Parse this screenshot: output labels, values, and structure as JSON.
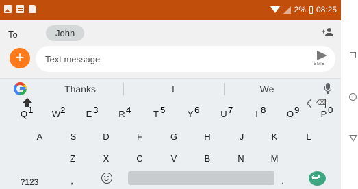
{
  "status_bar": {
    "notification_icons": [
      "image-icon",
      "calendar-icon",
      "document-icon"
    ],
    "battery": "2%",
    "time": "08:25"
  },
  "compose": {
    "to_label": "To",
    "recipient": "John",
    "add_contact_icon": "add-contact-icon",
    "add_button_symbol": "+",
    "message_placeholder": "Text message",
    "send_label": "SMS"
  },
  "keyboard": {
    "suggestions": [
      "Thanks",
      "I",
      "We"
    ],
    "row1": [
      {
        "key": "Q",
        "hint": "1"
      },
      {
        "key": "W",
        "hint": "2"
      },
      {
        "key": "E",
        "hint": "3"
      },
      {
        "key": "R",
        "hint": "4"
      },
      {
        "key": "T",
        "hint": "5"
      },
      {
        "key": "Y",
        "hint": "6"
      },
      {
        "key": "U",
        "hint": "7"
      },
      {
        "key": "I",
        "hint": "8"
      },
      {
        "key": "O",
        "hint": "9"
      },
      {
        "key": "P",
        "hint": "0"
      }
    ],
    "row2": [
      "A",
      "S",
      "D",
      "F",
      "G",
      "H",
      "J",
      "K",
      "L"
    ],
    "row3": [
      "Z",
      "X",
      "C",
      "V",
      "B",
      "N",
      "M"
    ],
    "symbols_label": "?123",
    "comma_label": ",",
    "period_label": ".",
    "backspace_symbol": "⌫",
    "colors": {
      "status_bar": "#c24e0c",
      "fab": "#ff7a1a",
      "enter": "#3da882"
    }
  }
}
